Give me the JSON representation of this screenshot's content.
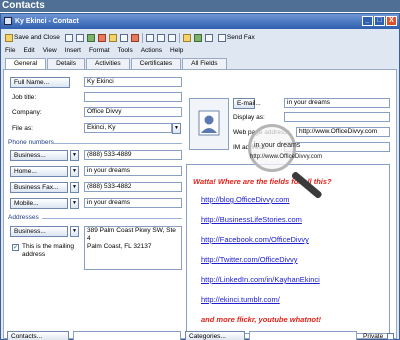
{
  "page_title": "Contacts",
  "window": {
    "title": "Ky Ekinci - Contact",
    "controls": {
      "minimize": "_",
      "maximize": "□",
      "close": "X"
    }
  },
  "toolbar": {
    "save_close": "Save and Close",
    "send_fax": "Send Fax"
  },
  "menu": [
    "File",
    "Edit",
    "View",
    "Insert",
    "Format",
    "Tools",
    "Actions",
    "Help"
  ],
  "tabs": [
    "General",
    "Details",
    "Activities",
    "Certificates",
    "All Fields"
  ],
  "form": {
    "full_name_button": "Full Name...",
    "full_name_value": "Ky Ekinci",
    "job_title_label": "Job title:",
    "job_title_value": "",
    "company_label": "Company:",
    "company_value": "Office Divvy",
    "file_as_label": "File as:",
    "file_as_value": "Ekinci, Ky",
    "phone_section": "Phone numbers",
    "phones": [
      {
        "button": "Business...",
        "value": "(888) 533-4889"
      },
      {
        "button": "Home...",
        "value": "in your dreams"
      },
      {
        "button": "Business Fax...",
        "value": "(888) 533-4882"
      },
      {
        "button": "Mobile...",
        "value": "in your dreams"
      }
    ],
    "address_section": "Addresses",
    "address_button": "Business...",
    "address_value_line1": "389 Palm Coast Pkwy SW, Ste 4",
    "address_value_line2": "Palm Coast, FL 32137",
    "mailing_check_line1": "This is the mailing",
    "mailing_check_line2": "address",
    "email_label": "E-mail...",
    "email_value": "in your dreams",
    "display_as_label": "Display as:",
    "web_label": "Web page address:",
    "web_value": "http://www.OfficeDivvy.com",
    "im_label": "IM address:"
  },
  "magnifier_text": {
    "line1": "in your dreams",
    "line2": "http://www.OfficeDivvy.com"
  },
  "notes": {
    "headline": "Watta!  Where are the fields for all this?",
    "links": [
      "http://blog.OfficeDivvy.com",
      "http://BusinessLifeStories.com",
      "http://Facebook.com/OfficeDivvy",
      "http://Twitter.com/OfficeDivvy",
      "http://LinkedIn.com/in/KayhanEkinci",
      "http://ekinci.tumblr.com/"
    ],
    "footer": "and more flickr, youtube whatnot!"
  },
  "bottom": {
    "contacts_button": "Contacts...",
    "categories_button": "Categories...",
    "private_label": "Private"
  }
}
